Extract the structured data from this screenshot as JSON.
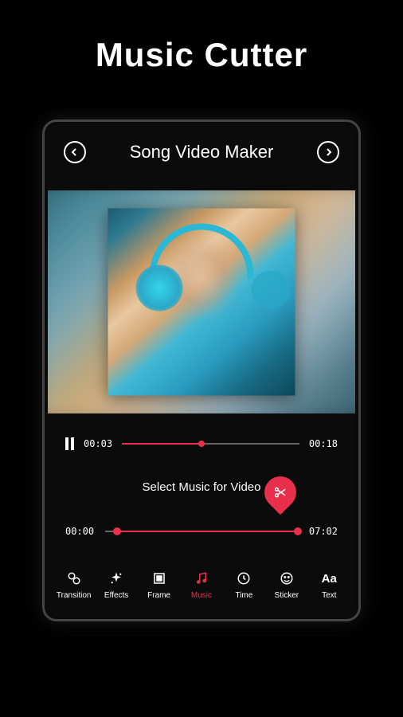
{
  "page": {
    "title": "Music Cutter"
  },
  "header": {
    "title": "Song Video Maker"
  },
  "playback": {
    "currentTime": "00:03",
    "totalTime": "00:18",
    "progressPercent": 45
  },
  "music": {
    "selectLabel": "Select Music for Video",
    "startTime": "00:00",
    "endTime": "07:02",
    "startPercent": 6,
    "endPercent": 100
  },
  "toolbar": {
    "items": [
      {
        "id": "transition",
        "label": "Transition",
        "active": false
      },
      {
        "id": "effects",
        "label": "Effects",
        "active": false
      },
      {
        "id": "frame",
        "label": "Frame",
        "active": false
      },
      {
        "id": "music",
        "label": "Music",
        "active": true
      },
      {
        "id": "time",
        "label": "Time",
        "active": false
      },
      {
        "id": "sticker",
        "label": "Sticker",
        "active": false
      },
      {
        "id": "text",
        "label": "Text",
        "active": false
      }
    ]
  },
  "colors": {
    "accent": "#e8304d",
    "background": "#000000",
    "text": "#ffffff"
  }
}
